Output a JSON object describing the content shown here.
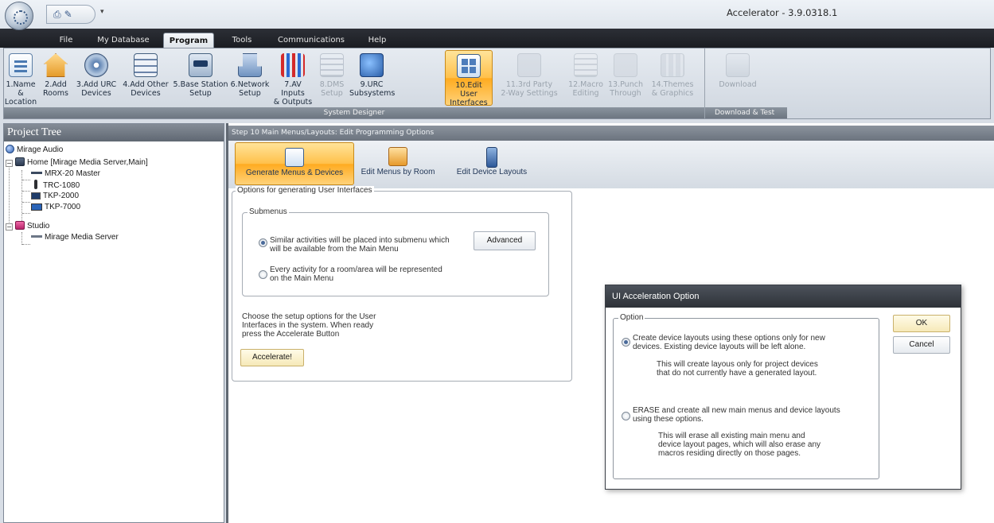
{
  "app": {
    "title": "Accelerator - 3.9.0318.1",
    "qat_dropdown": "▾"
  },
  "tabs": [
    {
      "label": "File"
    },
    {
      "label": "My Database"
    },
    {
      "label": "Program",
      "active": true
    },
    {
      "label": "Tools"
    },
    {
      "label": "Communications"
    },
    {
      "label": "Help"
    }
  ],
  "ribbon": {
    "buttons": [
      {
        "line1": "1.Name &",
        "line2": "Location",
        "icon": "document-icon"
      },
      {
        "line1": "2.Add",
        "line2": "Rooms",
        "icon": "house-icon"
      },
      {
        "line1": "3.Add URC",
        "line2": "Devices",
        "icon": "disc-icon"
      },
      {
        "line1": "4.Add Other",
        "line2": "Devices",
        "icon": "rack-icon"
      },
      {
        "line1": "5.Base Station",
        "line2": "Setup",
        "icon": "base-station-icon"
      },
      {
        "line1": "6.Network",
        "line2": "Setup",
        "icon": "network-icon"
      },
      {
        "line1": "7.AV Inputs",
        "line2": "& Outputs",
        "icon": "cables-icon"
      },
      {
        "line1": "8.DMS",
        "line2": "Setup",
        "icon": "dms-icon",
        "disabled": true
      },
      {
        "line1": "9.URC",
        "line2": "Subsystems",
        "icon": "urc-icon"
      },
      {
        "line1": "10.Edit User",
        "line2": "Interfaces",
        "icon": "edit-ui-icon",
        "selected": true
      },
      {
        "line1": "11.3rd Party",
        "line2": "2-Way Settings",
        "icon": "third-party-icon",
        "disabled": true
      },
      {
        "line1": "12.Macro",
        "line2": "Editing",
        "icon": "macro-icon",
        "disabled": true
      },
      {
        "line1": "13.Punch",
        "line2": "Through",
        "icon": "punch-icon",
        "disabled": true
      },
      {
        "line1": "14.Themes",
        "line2": "& Graphics",
        "icon": "themes-icon",
        "disabled": true
      }
    ],
    "group_label": "System Designer",
    "download_label": "Download",
    "download_group_label": "Download & Test"
  },
  "tree": {
    "title": "Project Tree",
    "nodes": {
      "root": "Mirage Audio",
      "home": "Home [Mirage Media Server,Main]",
      "mrx": "MRX-20 Master",
      "trc": "TRC-1080",
      "tkp2000": "TKP-2000",
      "tkp7000": "TKP-7000",
      "studio": "Studio",
      "mms": "Mirage Media Server"
    },
    "expand_symbol": "−"
  },
  "main": {
    "step_title": "Step 10 Main Menus/Layouts: Edit Programming Options",
    "subtabs": [
      {
        "label": "Generate Menus & Devices",
        "selected": true
      },
      {
        "label": "Edit Menus by Room"
      },
      {
        "label": "Edit Device Layouts"
      }
    ],
    "options_legend": "Options for generating User Interfaces",
    "submenus_legend": "Submenus",
    "option1_line1": "Similar activities will be placed into submenu which",
    "option1_line2": "will be available from the Main Menu",
    "option2_line1": "Every activity for a room/area will be represented",
    "option2_line2": "on the Main Menu",
    "advanced_label": "Advanced",
    "help_line1": "Choose the setup options for the User",
    "help_line2": "Interfaces in the system. When ready",
    "help_line3": "press the Accelerate Button",
    "accelerate_label": "Accelerate!"
  },
  "dialog": {
    "title": "UI Acceleration Option",
    "group_legend": "Option",
    "opt1_line1": "Create device layouts using these options only for new",
    "opt1_line2": "devices. Existing device layouts will be left alone.",
    "opt1_desc1": "This will create layous only for project devices",
    "opt1_desc2": "that do not currently have a generated layout.",
    "opt2_line1": "ERASE and create all new main menus and device layouts",
    "opt2_line2": "using these options.",
    "opt2_desc1": "This will erase all existing main menu and",
    "opt2_desc2": "device layout pages, which will also erase any",
    "opt2_desc3": "macros residing directly on those pages.",
    "ok_label": "OK",
    "cancel_label": "Cancel"
  }
}
